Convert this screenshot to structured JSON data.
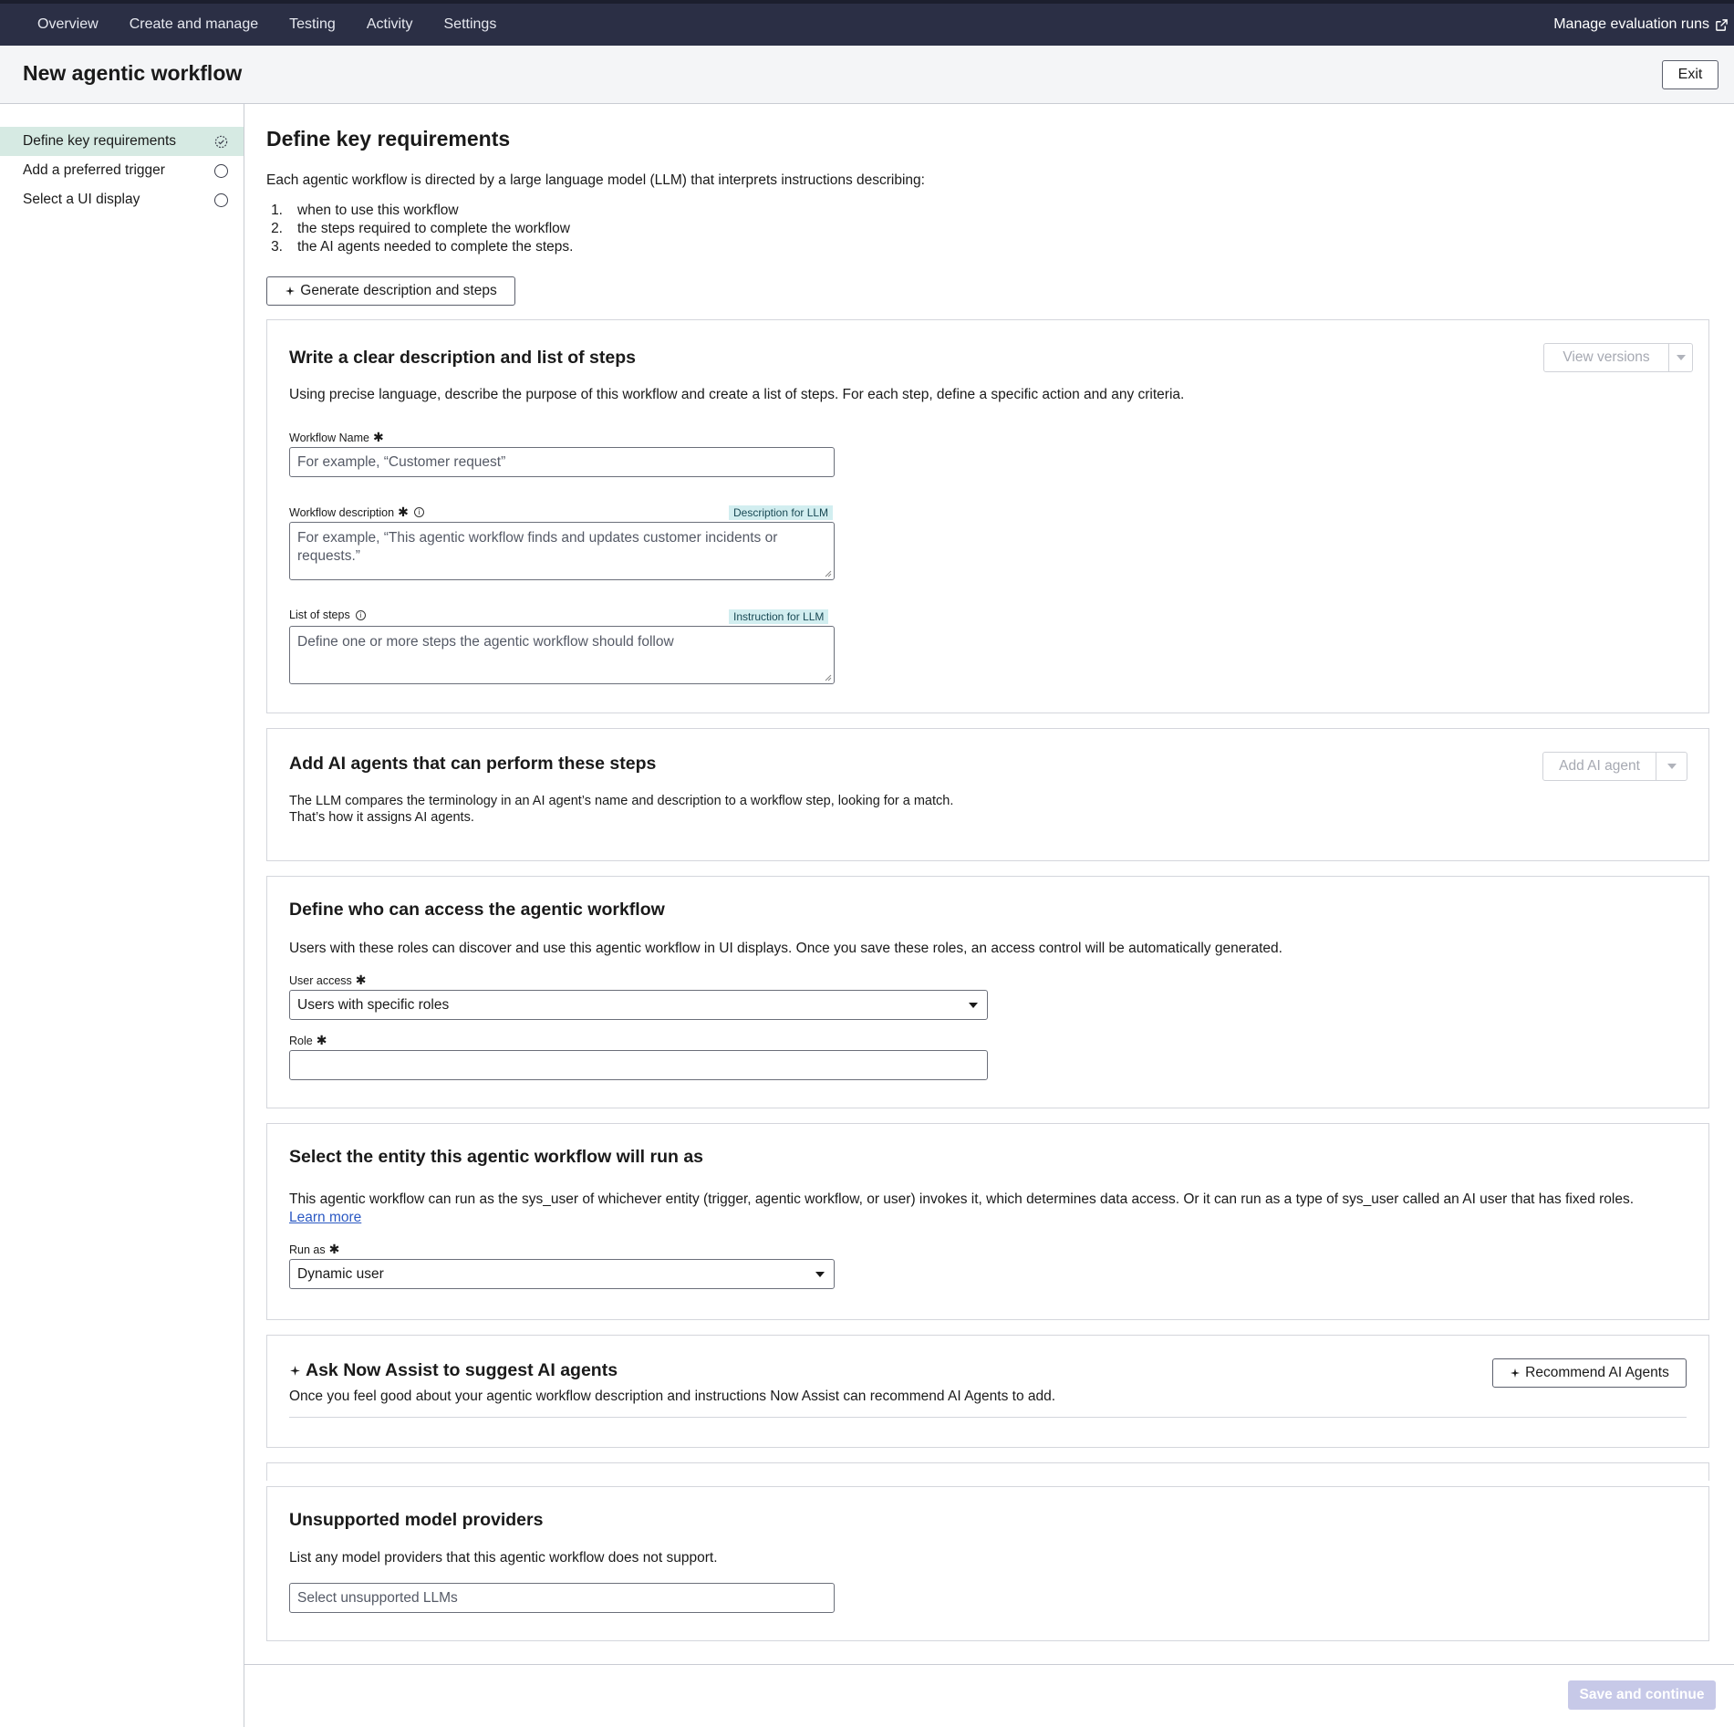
{
  "topnav": {
    "items": [
      "Overview",
      "Create and manage",
      "Testing",
      "Activity",
      "Settings"
    ],
    "manage_runs": "Manage evaluation runs"
  },
  "header": {
    "title": "New agentic workflow",
    "exit_label": "Exit"
  },
  "sidebar": {
    "items": [
      {
        "label": "Define key requirements",
        "state": "in-progress"
      },
      {
        "label": "Add a preferred trigger",
        "state": "not-started"
      },
      {
        "label": "Select a UI display",
        "state": "not-started"
      }
    ]
  },
  "main": {
    "title": "Define key requirements",
    "intro": "Each agentic workflow is directed by a large language model (LLM) that interprets instructions describing:",
    "list": [
      {
        "num": "1.",
        "text": "when to use this workflow"
      },
      {
        "num": "2.",
        "text": "the steps required to complete the workflow"
      },
      {
        "num": "3.",
        "text": "the AI agents needed to complete the steps."
      }
    ],
    "generate_btn": "Generate description and steps"
  },
  "card_description": {
    "title": "Write a clear description and list of steps",
    "desc": "Using precise language, describe the purpose of this workflow and create a list of steps. For each step, define a specific action and any criteria.",
    "view_versions": "View versions",
    "name_label": "Workflow Name",
    "name_placeholder": "For example, “Customer request”",
    "desc_label": "Workflow description",
    "desc_tag": "Description for LLM",
    "desc_placeholder": "For example, “This agentic workflow finds and updates customer incidents or requests.”",
    "steps_label": "List of steps",
    "steps_tag": "Instruction for LLM",
    "steps_placeholder": "Define one or more steps the agentic workflow should follow"
  },
  "card_agents": {
    "title": "Add AI agents that can perform these steps",
    "desc_line1": "The LLM compares the terminology in an AI agent’s name and description to a workflow step, looking for a match.",
    "desc_line2": "That’s how it assigns AI agents.",
    "add_btn": "Add AI agent"
  },
  "card_access": {
    "title": "Define who can access the agentic workflow",
    "desc": "Users with these roles can discover and use this agentic workflow in UI displays. Once you save these roles, an access control will be automatically generated.",
    "user_access_label": "User access",
    "user_access_value": "Users with specific roles",
    "role_label": "Role",
    "role_value": ""
  },
  "card_runas": {
    "title": "Select the entity this agentic workflow will run as",
    "desc": "This agentic workflow can run as the sys_user of whichever entity (trigger, agentic workflow, or user) invokes it, which determines data access. Or it can run as a type of sys_user called an AI user that has fixed roles.",
    "learn_more": "Learn more",
    "run_as_label": "Run as",
    "run_as_value": "Dynamic user"
  },
  "card_assist": {
    "title": "Ask Now Assist to suggest AI agents",
    "desc": "Once you feel good about your agentic workflow description and instructions Now Assist can recommend AI Agents to add.",
    "recommend_btn": "Recommend AI Agents"
  },
  "card_providers": {
    "title": "Unsupported model providers",
    "desc": "List any model providers that this agentic workflow does not support.",
    "placeholder": "Select unsupported LLMs"
  },
  "footer": {
    "save_label": "Save and continue"
  },
  "colors": {
    "nav_bg": "#2b2f45",
    "active_step": "#d6eae3",
    "llm_tag": "#d2eef0",
    "save_disabled": "#c7c9e8",
    "link": "#2b59c3"
  }
}
